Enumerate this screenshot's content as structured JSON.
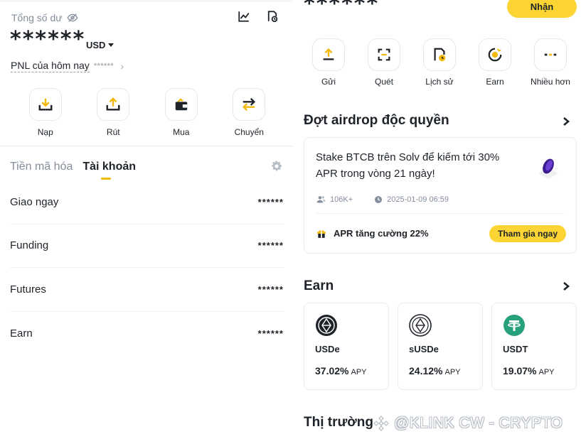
{
  "left": {
    "balance_label": "Tổng số dư",
    "balance_hidden": "******",
    "currency": "USD",
    "pnl_label": "PNL của hôm nay",
    "pnl_value": "******",
    "actions": [
      {
        "label": "Nạp",
        "icon": "deposit-icon"
      },
      {
        "label": "Rút",
        "icon": "withdraw-icon"
      },
      {
        "label": "Mua",
        "icon": "buy-wallet-icon"
      },
      {
        "label": "Chuyển",
        "icon": "transfer-icon"
      }
    ],
    "tabs": [
      "Tiền mã hóa",
      "Tài khoản"
    ],
    "active_tab": "Tài khoản",
    "accounts": [
      {
        "name": "Giao ngay",
        "amount": "******"
      },
      {
        "name": "Funding",
        "amount": "******"
      },
      {
        "name": "Futures",
        "amount": "******"
      },
      {
        "name": "Earn",
        "amount": "******"
      }
    ]
  },
  "right": {
    "balance_hidden": "******",
    "claim_label": "Nhận",
    "actions": [
      {
        "label": "Gửi",
        "icon": "send-icon"
      },
      {
        "label": "Quét",
        "icon": "scan-icon"
      },
      {
        "label": "Lịch sử",
        "icon": "history-icon"
      },
      {
        "label": "Earn",
        "icon": "earn-icon"
      },
      {
        "label": "Nhiều hơn",
        "icon": "more-icon"
      }
    ],
    "airdrop": {
      "title": "Đợt airdrop độc quyền",
      "description": "Stake BTCB trên Solv để kiếm tới 30% APR trong vòng 21 ngày!",
      "participants": "106K+",
      "date": "2025-01-09 06:59",
      "boost": "APR tăng cường 22%",
      "join_label": "Tham gia ngay"
    },
    "earn": {
      "title": "Earn",
      "products": [
        {
          "symbol": "USDe",
          "apy": "37.02%",
          "apy_label": "APY",
          "icon": "usde-coin-icon"
        },
        {
          "symbol": "sUSDe",
          "apy": "24.12%",
          "apy_label": "APY",
          "icon": "susde-coin-icon"
        },
        {
          "symbol": "USDT",
          "apy": "19.07%",
          "apy_label": "APY",
          "icon": "usdt-coin-icon"
        }
      ]
    },
    "market_title": "Thị trường"
  },
  "watermark": "@KLINK CW - CRYPTO",
  "colors": {
    "accent": "#fcd535",
    "text": "#1e2329",
    "muted": "#848e9c",
    "usdt": "#26a17b"
  }
}
